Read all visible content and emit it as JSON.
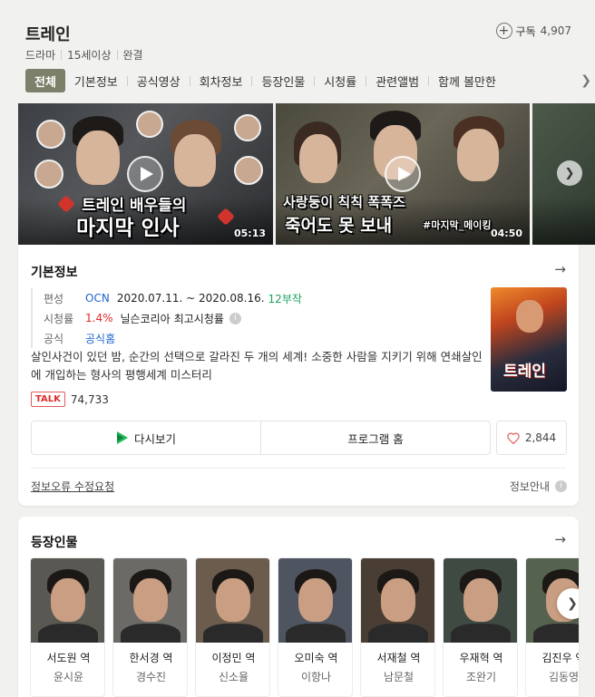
{
  "header": {
    "title": "트레인",
    "meta": [
      "드라마",
      "15세이상",
      "완결"
    ],
    "subscribe_label": "구독",
    "subscribe_count": "4,907"
  },
  "tabs": [
    {
      "label": "전체",
      "active": true
    },
    {
      "label": "기본정보"
    },
    {
      "label": "공식영상"
    },
    {
      "label": "회차정보"
    },
    {
      "label": "등장인물"
    },
    {
      "label": "시청률"
    },
    {
      "label": "관련앨범"
    },
    {
      "label": "함께 볼만한"
    }
  ],
  "videos": [
    {
      "caption_top": "트레인 배우들의",
      "caption_bottom": "마지막 인사",
      "duration": "05:13"
    },
    {
      "caption_top": "사랑둥이 칙칙 폭폭즈",
      "caption_bottom": "죽어도 못 보내",
      "tag": "#마지막_메이킹",
      "duration": "04:50"
    }
  ],
  "info": {
    "section_title": "기본정보",
    "rows": {
      "broadcast": {
        "label": "편성",
        "channel": "OCN",
        "period": "2020.07.11. ~ 2020.08.16.",
        "episodes": "12부작"
      },
      "rating": {
        "label": "시청률",
        "value": "1.4%",
        "source": "닐슨코리아",
        "best": "최고시청률"
      },
      "official": {
        "label": "공식",
        "link": "공식홈"
      }
    },
    "description": "살인사건이 있던 밤, 순간의 선택으로 갈라진 두 개의 세계! 소중한 사람을 지키기 위해 연쇄살인에 개입하는 형사의 평행세계 미스터리",
    "poster_title": "트레인",
    "talk_badge": "TALK",
    "talk_count": "74,733",
    "buttons": {
      "replay": "다시보기",
      "program_home": "프로그램 홈",
      "like_count": "2,844"
    },
    "footer_left": "정보오류 수정요청",
    "footer_right": "정보안내"
  },
  "cast": {
    "section_title": "등장인물",
    "items": [
      {
        "role": "서도원 역",
        "actor": "윤시윤",
        "bg": "#5a5852"
      },
      {
        "role": "한서경 역",
        "actor": "경수진",
        "bg": "#6b6a66"
      },
      {
        "role": "이정민 역",
        "actor": "신소율",
        "bg": "#6b5c4e"
      },
      {
        "role": "오미숙 역",
        "actor": "이항나",
        "bg": "#4e5560"
      },
      {
        "role": "서재철 역",
        "actor": "남문철",
        "bg": "#4a3e34"
      },
      {
        "role": "우재혁 역",
        "actor": "조완기",
        "bg": "#3f4a42"
      },
      {
        "role": "김진우 역",
        "actor": "김동영",
        "bg": "#55624e"
      }
    ]
  },
  "icons": {
    "plus": "plus-icon",
    "play": "play-icon",
    "chevron": "chevron-right-icon",
    "arrow": "arrow-right-icon",
    "info": "info-icon",
    "heart": "heart-icon",
    "tving": "tving-play-icon"
  },
  "colors": {
    "tab_active": "#7c8068",
    "link_blue": "#1f65cc",
    "rating_red": "#e22b2b",
    "episodes_green": "#1aa35d",
    "talk_red": "#e22b2b"
  }
}
